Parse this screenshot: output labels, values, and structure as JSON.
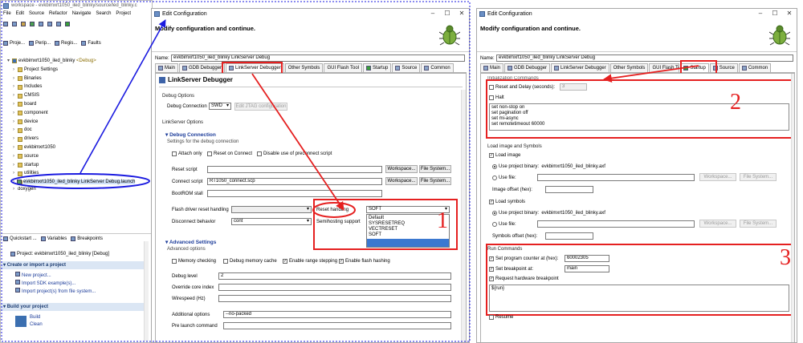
{
  "ide": {
    "title": "workspace - evkbimxrt1050_iled_blinky/source/led_blinky.c",
    "menu": [
      "File",
      "Edit",
      "Source",
      "Refactor",
      "Navigate",
      "Search",
      "Project"
    ],
    "view_tabs": [
      "Proje...",
      "Perip...",
      "Regis...",
      "Faults"
    ],
    "tree_root": "evkbimxrt1050_iled_blinky",
    "tree_root_tag": "<Debug>",
    "tree_items": [
      "Project Settings",
      "Binaries",
      "Includes",
      "CMSIS",
      "board",
      "component",
      "device",
      "doc",
      "drivers",
      "evkbimxrt1050",
      "source",
      "startup",
      "utilities",
      "xip"
    ],
    "tree_partial": "doxygen",
    "launch_file": "evkbimxrt1050_iled_blinky LinkServer Debug.launch",
    "bottom_tabs": [
      "Quickstart ...",
      "Variables",
      "Breakpoints"
    ],
    "project_line": "Project: evkbimxrt1050_iled_blinky [Debug]",
    "create_section": "Create or import a project",
    "create_links": [
      "New project...",
      "Import SDK example(s)...",
      "Import project(s) from file system..."
    ],
    "build_section": "Build your project",
    "build_links": [
      "Build",
      "Clean"
    ]
  },
  "dlg1": {
    "title": "Edit Configuration",
    "header": "Modify configuration and continue.",
    "name_label": "Name:",
    "name_value": "evkbimxrt1050_iled_blinky LinkServer Debug",
    "tabs": [
      "Main",
      "GDB Debugger",
      "LinkServer Debugger",
      "Other Symbols",
      "GUI Flash Tool",
      "Startup",
      "Source",
      "Common"
    ],
    "panel_title": "LinkServer Debugger",
    "debug_options": "Debug Options",
    "debug_connection_label": "Debug Connection",
    "debug_connection_value": "SWD",
    "edit_jtag": "Edit JTAG configuration",
    "linkserver_options": "LinkServer Options",
    "debug_conn_section": "Debug Connection",
    "settings_for": "Settings for the debug connection",
    "attach_only": "Attach only",
    "reset_on_connect": "Reset on Connect",
    "disable_preconnect": "Disable use of preconnect script",
    "reset_script": "Reset script",
    "connect_script": "Connect script",
    "connect_script_value": "RT1050_connect.scp",
    "bootrom_stall": "BootROM stall",
    "workspace_btn": "Workspace...",
    "filesystem_btn": "File System...",
    "flash_driver_reset": "Flash driver reset handling",
    "disconnect_behavior": "Disconnect behavior",
    "disconnect_value": "cont",
    "reset_handling": "Reset handling",
    "reset_handling_value": "SOFT",
    "semihosting": "Semihosting support",
    "dropdown_options": [
      "Default",
      "SYSRESETREQ",
      "VECTRESET",
      "SOFT"
    ],
    "advanced_section": "Advanced Settings",
    "advanced_options": "Advanced options",
    "memory_checking": "Memory checking",
    "debug_memory_cache": "Debug memory cache",
    "enable_range_stepping": "Enable range stepping",
    "enable_flash_hashing": "Enable flash hashing",
    "debug_level": "Debug level",
    "debug_level_value": "2",
    "override_core": "Override core index",
    "wirespeed": "Wirespeed (Hz)",
    "additional_options": "Additional options",
    "additional_value": "--no-packed",
    "pre_launch": "Pre launch command"
  },
  "dlg2": {
    "title": "Edit Configuration",
    "header": "Modify configuration and continue.",
    "name_label": "Name:",
    "name_value": "evkbimxrt1050_iled_blinky LinkServer Debug",
    "tabs": [
      "Main",
      "GDB Debugger",
      "LinkServer Debugger",
      "Other Symbols",
      "GUI Flash Tool",
      "Startup",
      "Source",
      "Common"
    ],
    "init_commands": "Initialization Commands",
    "reset_delay": "Reset and Delay (seconds):",
    "reset_delay_value": "3",
    "halt": "Halt",
    "init_lines": [
      "set non-stop on",
      "set pagination off",
      "set mi-async",
      "set remotetimeout 60000"
    ],
    "load_image_section": "Load image and Symbols",
    "load_image": "Load image",
    "use_project_binary": "Use project binary:",
    "project_binary": "evkbimxrt1050_iled_blinky.axf",
    "use_file": "Use file:",
    "workspace_btn": "Workspace...",
    "filesystem_btn": "File System...",
    "image_offset": "Image offset (hex):",
    "load_symbols": "Load symbols",
    "symbols_offset": "Symbols offset (hex):",
    "run_commands": "Run Commands",
    "set_pc": "Set program counter at (hex):",
    "set_pc_value": "60002305",
    "set_bp": "Set breakpoint at:",
    "set_bp_value": "main",
    "request_hw_bp": "Request hardware breakpoint",
    "run_text": "${run}",
    "resume": "Resume"
  },
  "annotations": {
    "n1": "1",
    "n2": "2",
    "n3": "3"
  },
  "colors": {
    "annotation": "#e52020",
    "arrow": "#1a1ae0",
    "highlight": "#3b78d0"
  }
}
